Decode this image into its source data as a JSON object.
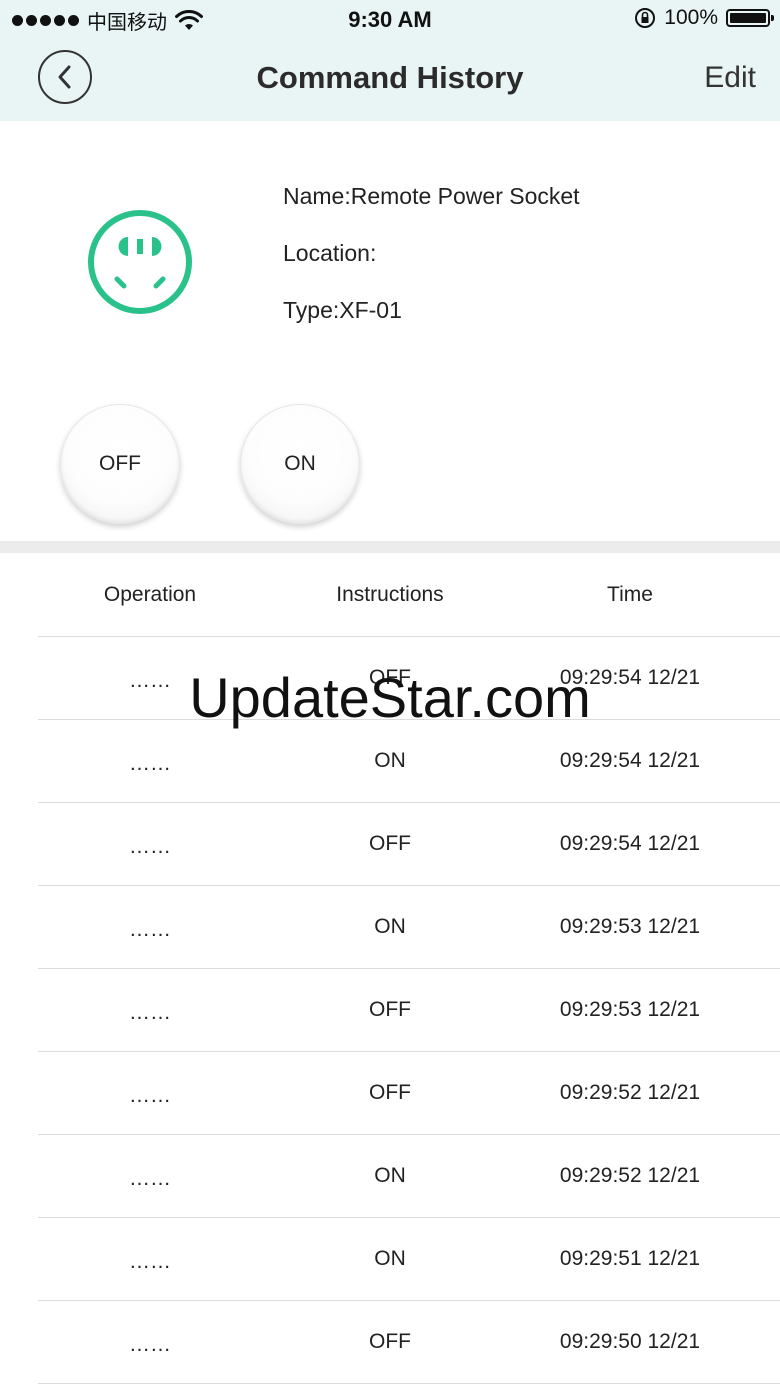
{
  "status_bar": {
    "carrier": "中国移动",
    "time": "9:30 AM",
    "battery_text": "100%",
    "battery_level": 1.0
  },
  "navbar": {
    "title": "Command History",
    "edit_label": "Edit",
    "back_icon": "chevron-left-icon"
  },
  "device": {
    "icon": "socket-icon",
    "icon_color": "#2ac28a",
    "name": "Name:Remote Power Socket",
    "location": "Location:",
    "type": "Type:XF-01",
    "off_label": "OFF",
    "on_label": "ON"
  },
  "table": {
    "headers": [
      "Operation",
      "Instructions",
      "Time"
    ],
    "rows": [
      {
        "operation": "……",
        "instruction": "OFF",
        "time": "09:29:54 12/21"
      },
      {
        "operation": "……",
        "instruction": "ON",
        "time": "09:29:54 12/21"
      },
      {
        "operation": "……",
        "instruction": "OFF",
        "time": "09:29:54 12/21"
      },
      {
        "operation": "……",
        "instruction": "ON",
        "time": "09:29:53 12/21"
      },
      {
        "operation": "……",
        "instruction": "OFF",
        "time": "09:29:53 12/21"
      },
      {
        "operation": "……",
        "instruction": "OFF",
        "time": "09:29:52 12/21"
      },
      {
        "operation": "……",
        "instruction": "ON",
        "time": "09:29:52 12/21"
      },
      {
        "operation": "……",
        "instruction": "ON",
        "time": "09:29:51 12/21"
      },
      {
        "operation": "……",
        "instruction": "OFF",
        "time": "09:29:50 12/21"
      }
    ]
  },
  "watermark": "UpdateStar.com"
}
